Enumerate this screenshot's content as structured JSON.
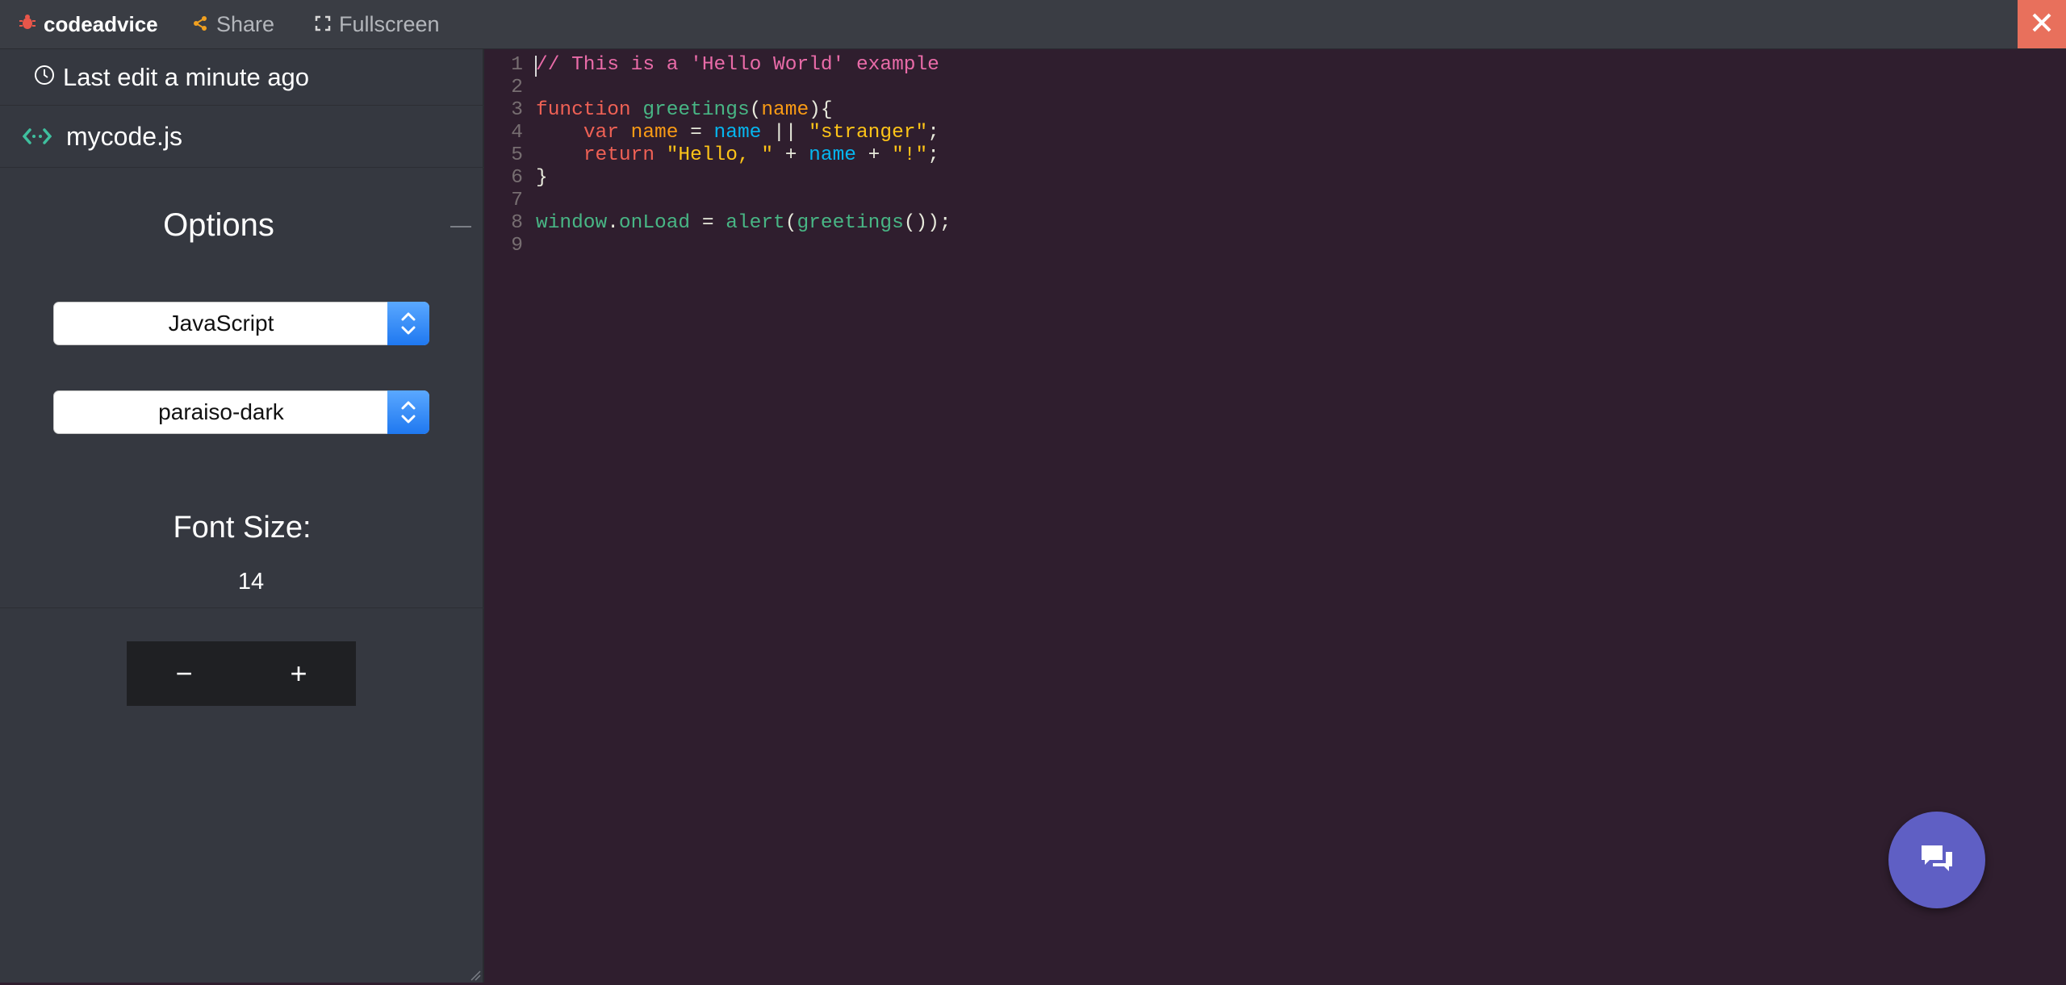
{
  "topbar": {
    "brand": "codeadvice",
    "share_label": "Share",
    "fullscreen_label": "Fullscreen",
    "brand_icon": "bug-icon",
    "share_icon": "share-icon",
    "fullscreen_icon": "expand-icon",
    "close_icon": "close-icon",
    "close_color": "#e8705c"
  },
  "sidebar": {
    "last_edit": "Last edit a minute ago",
    "filename": "mycode.js",
    "options_title": "Options",
    "language": "JavaScript",
    "theme": "paraiso-dark",
    "font_size_label": "Font Size:",
    "font_size": "14",
    "decrease_label": "−",
    "increase_label": "+"
  },
  "editor": {
    "line_numbers": [
      "1",
      "2",
      "3",
      "4",
      "5",
      "6",
      "7",
      "8",
      "9"
    ],
    "lines": [
      [
        {
          "t": "// This is a 'Hello World' example",
          "c": "t-comment"
        }
      ],
      [],
      [
        {
          "t": "function",
          "c": "t-keyword"
        },
        {
          "t": " ",
          "c": "t-op"
        },
        {
          "t": "greetings",
          "c": "t-def"
        },
        {
          "t": "(",
          "c": "t-op"
        },
        {
          "t": "name",
          "c": "t-var"
        },
        {
          "t": "){",
          "c": "t-op"
        }
      ],
      [
        {
          "t": "    ",
          "c": "t-op"
        },
        {
          "t": "var",
          "c": "t-keyword"
        },
        {
          "t": " ",
          "c": "t-op"
        },
        {
          "t": "name",
          "c": "t-var"
        },
        {
          "t": " = ",
          "c": "t-op"
        },
        {
          "t": "name",
          "c": "t-var2"
        },
        {
          "t": " || ",
          "c": "t-op"
        },
        {
          "t": "\"stranger\"",
          "c": "t-string"
        },
        {
          "t": ";",
          "c": "t-op"
        }
      ],
      [
        {
          "t": "    ",
          "c": "t-op"
        },
        {
          "t": "return",
          "c": "t-keyword"
        },
        {
          "t": " ",
          "c": "t-op"
        },
        {
          "t": "\"Hello, \"",
          "c": "t-string"
        },
        {
          "t": " + ",
          "c": "t-op"
        },
        {
          "t": "name",
          "c": "t-var2"
        },
        {
          "t": " + ",
          "c": "t-op"
        },
        {
          "t": "\"!\"",
          "c": "t-string"
        },
        {
          "t": ";",
          "c": "t-op"
        }
      ],
      [
        {
          "t": "}",
          "c": "t-op"
        }
      ],
      [],
      [
        {
          "t": "window",
          "c": "t-prop"
        },
        {
          "t": ".",
          "c": "t-op"
        },
        {
          "t": "onLoad",
          "c": "t-prop"
        },
        {
          "t": " = ",
          "c": "t-op"
        },
        {
          "t": "alert",
          "c": "t-prop"
        },
        {
          "t": "(",
          "c": "t-op"
        },
        {
          "t": "greetings",
          "c": "t-prop"
        },
        {
          "t": "());",
          "c": "t-op"
        }
      ],
      []
    ],
    "background": "#2f1e2e"
  },
  "chat": {
    "icon": "chat-bubbles-icon",
    "color": "#5f5fc4"
  }
}
